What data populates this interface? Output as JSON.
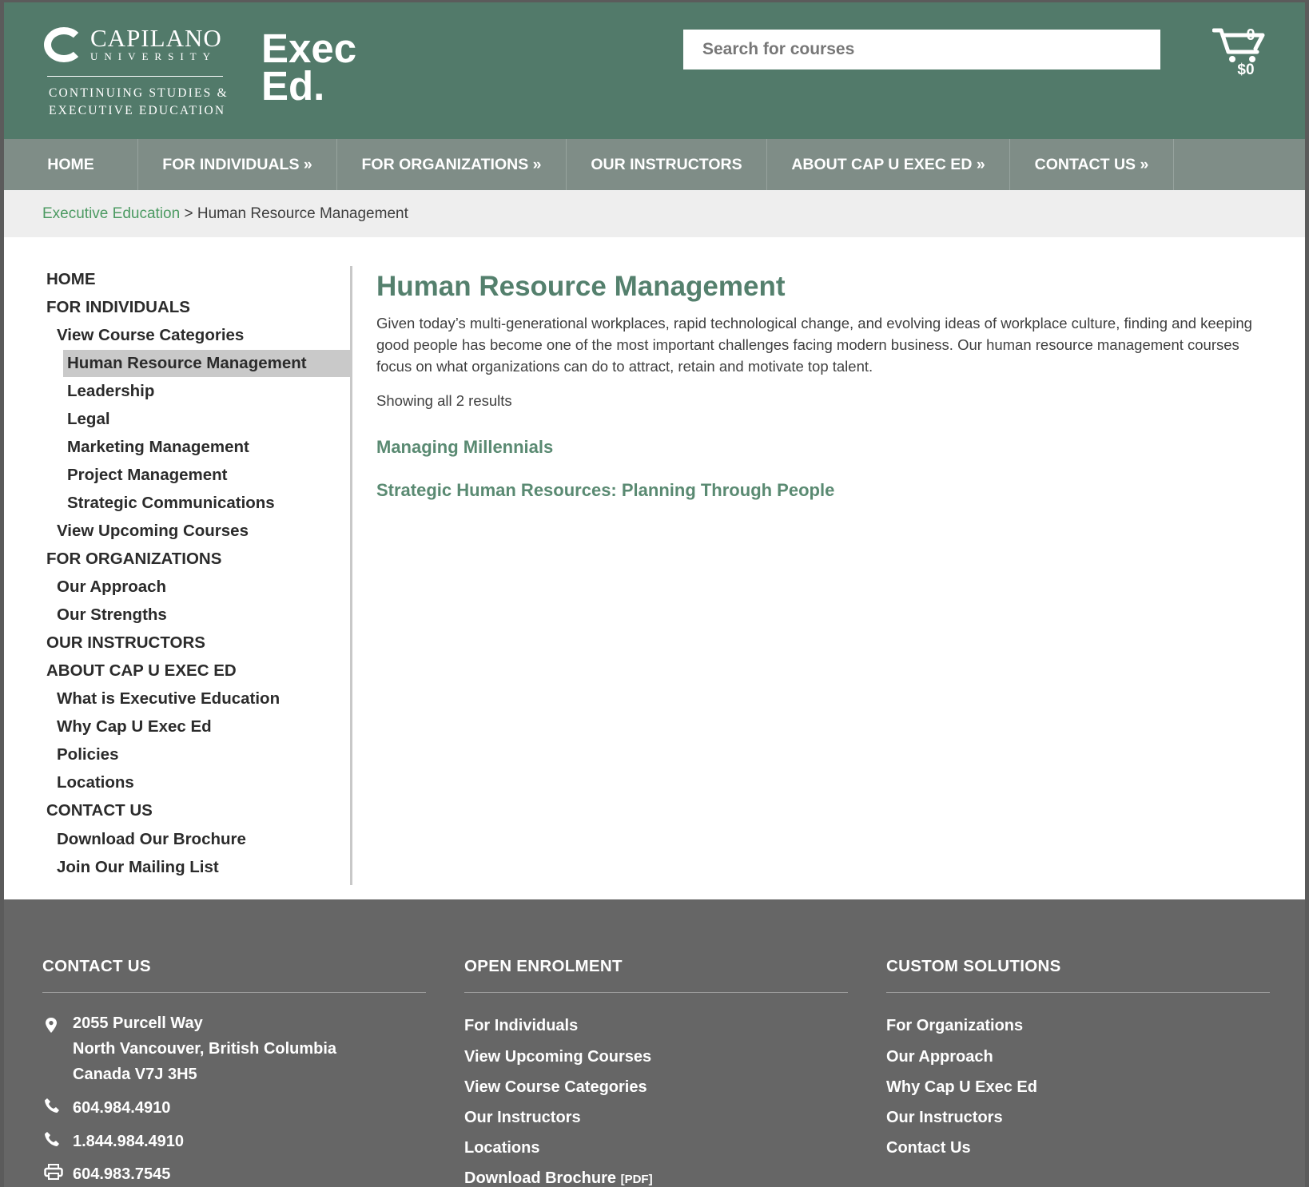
{
  "brand": {
    "name": "CAPILANO",
    "university": "UNIVERSITY",
    "line1": "CONTINUING STUDIES &",
    "line2": "EXECUTIVE EDUCATION",
    "exec_line1": "Exec",
    "exec_line2": "Ed."
  },
  "search": {
    "placeholder": "Search for courses"
  },
  "cart": {
    "count": "0",
    "total": "$0"
  },
  "nav": [
    "HOME",
    "FOR INDIVIDUALS »",
    "FOR ORGANIZATIONS »",
    "OUR INSTRUCTORS",
    "ABOUT CAP U EXEC ED »",
    "CONTACT US »"
  ],
  "breadcrumb": {
    "link": "Executive Education",
    "separator": ">",
    "current": "Human Resource Management"
  },
  "sidebar": [
    "HOME",
    "FOR INDIVIDUALS",
    "View Course Categories",
    "Human Resource Management",
    "Leadership",
    "Legal",
    "Marketing Management",
    "Project Management",
    "Strategic Communications",
    "View Upcoming Courses",
    "FOR ORGANIZATIONS",
    "Our Approach",
    "Our Strengths",
    "OUR INSTRUCTORS",
    "ABOUT CAP U EXEC ED",
    "What is Executive Education",
    "Why Cap U Exec Ed",
    "Policies",
    "Locations",
    "CONTACT US",
    "Download Our Brochure",
    "Join Our Mailing List"
  ],
  "content": {
    "title": "Human Resource Management",
    "intro": "Given today’s multi-generational workplaces, rapid technological change, and evolving ideas of workplace culture, finding and keeping good people has become one of the most important challenges facing modern business. Our human resource management courses focus on what organizations can do to attract, retain and motivate top talent.",
    "results": "Showing all 2 results",
    "courses": [
      "Managing Millennials",
      "Strategic Human Resources: Planning Through People"
    ]
  },
  "footer": {
    "contact": {
      "heading": "CONTACT US",
      "address1": "2055 Purcell Way",
      "address2": "North Vancouver, British Columbia",
      "address3": "Canada V7J 3H5",
      "phone1": "604.984.4910",
      "phone2": "1.844.984.4910",
      "fax": "604.983.7545"
    },
    "open": {
      "heading": "OPEN ENROLMENT",
      "links": [
        "For Individuals",
        "View Upcoming Courses",
        "View Course Categories",
        "Our Instructors",
        "Locations",
        "Download Brochure"
      ],
      "pdf_tag": "[PDF]"
    },
    "custom": {
      "heading": "CUSTOM SOLUTIONS",
      "links": [
        "For Organizations",
        "Our Approach",
        "Why Cap U Exec Ed",
        "Our Instructors",
        "Contact Us"
      ]
    }
  },
  "icons": {
    "cart": "shopping-cart-icon",
    "location": "map-pin-icon",
    "phone": "phone-icon",
    "fax": "printer-icon"
  },
  "colors": {
    "header": "#527a6a",
    "nav": "#7f8d87",
    "accent_green": "#54806d",
    "link_green": "#4c9a62",
    "footer": "#666666"
  }
}
